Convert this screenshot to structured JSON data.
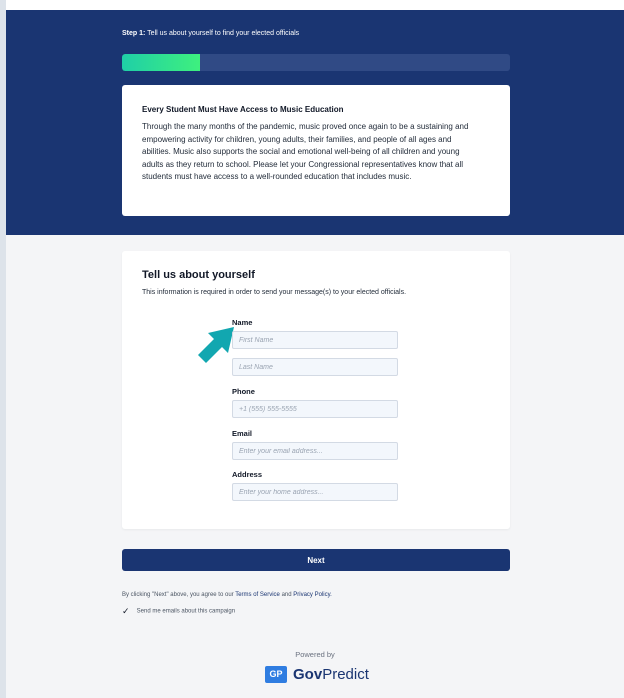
{
  "header": {
    "step_prefix": "Step 1:",
    "step_text": "Tell us about yourself to find your elected officials",
    "progress": 0.2
  },
  "intro": {
    "title": "Every Student Must Have Access to Music Education",
    "body": "Through the many months of the pandemic, music proved once again to be a sustaining and empowering activity for children, young adults, their families, and people of all ages and abilities. Music also supports the social and emotional well-being of all children and young adults as they return to school. Please let your Congressional representatives know that all students must have access to a well-rounded education that includes music."
  },
  "form": {
    "title": "Tell us about yourself",
    "subtitle": "This information is required in order to send your message(s) to your elected officials.",
    "name_label": "Name",
    "first_name_placeholder": "First Name",
    "last_name_placeholder": "Last Name",
    "phone_label": "Phone",
    "phone_placeholder": "+1 (555) 555-5555",
    "email_label": "Email",
    "email_placeholder": "Enter your email address...",
    "address_label": "Address",
    "address_placeholder": "Enter your home address..."
  },
  "next_label": "Next",
  "footer": {
    "terms_prefix": "By clicking \"Next\" above, you agree to our",
    "terms_link": "Terms of Service",
    "and": "and",
    "privacy_link": "Privacy Policy.",
    "optin_checkmark": "✓",
    "optin_label": "Send me emails about this campaign",
    "powered_by": "Powered by",
    "brand_badge": "GP",
    "brand_bold": "Gov",
    "brand_rest": "Predict"
  },
  "colors": {
    "header_bg": "#1a3572",
    "progress_fill_start": "#1fcfa7",
    "progress_fill_end": "#3ef07e",
    "arrow": "#12a7b0",
    "brand_badge": "#2f7de1"
  },
  "icons": {
    "pointer": "arrow-pointer-icon",
    "checkbox": "checkmark-icon"
  }
}
